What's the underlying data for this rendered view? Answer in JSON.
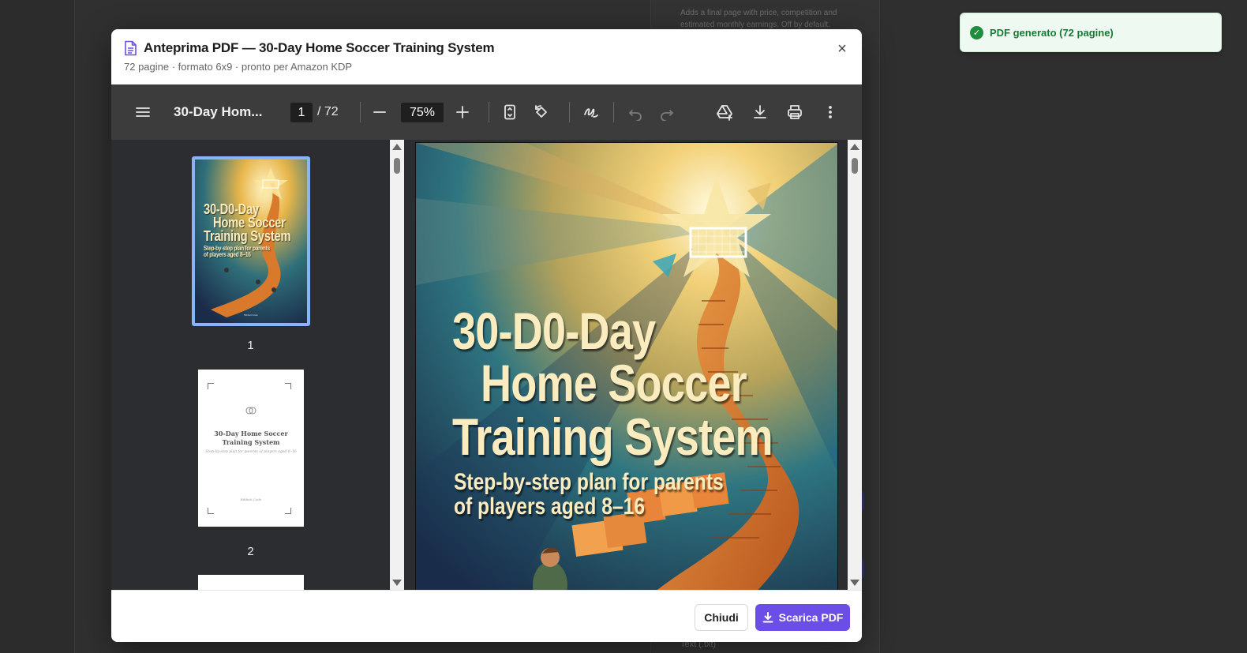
{
  "background": {
    "hint_text": "Adds a final page with price, competition and estimated monthly earnings. Off by default.",
    "footer_text": "Text (.txt)"
  },
  "toast": {
    "message": "PDF generato (72 pagine)",
    "icon": "check-circle-icon",
    "color": "#1e8e3e"
  },
  "modal": {
    "title": "Anteprima PDF — 30-Day Home Soccer Training System",
    "subtitle": "72 pagine · formato 6x9 · pronto per Amazon KDP",
    "close_symbol": "×"
  },
  "viewer": {
    "doc_name": "30-Day Hom...",
    "current_page": "1",
    "total_pages": "/ 72",
    "zoom": "75%",
    "toolbar_icons": [
      "menu-icon",
      "zoom-out-icon",
      "zoom-in-icon",
      "fit-page-icon",
      "rotate-icon",
      "annotate-icon",
      "undo-icon",
      "redo-icon",
      "save-to-drive-icon",
      "download-icon",
      "print-icon",
      "more-options-icon"
    ]
  },
  "thumbnails": [
    {
      "number": "1",
      "lines": [
        "30-D0-Day",
        "Home Soccer",
        "Training System"
      ],
      "sub": [
        "Step-by-step plan for parents",
        "of players aged 8–16"
      ]
    },
    {
      "number": "2",
      "title_lines": [
        "30-Day Home Soccer",
        "Training System"
      ],
      "sub": "Step-by-step plan for parents of players aged 8–16",
      "author": "Bibhuti Code"
    }
  ],
  "cover": {
    "title_line1": "30-D0-Day",
    "title_line2": "Home Soccer",
    "title_line3": "Training System",
    "subtitle_line1": "Step-by-step plan for parents",
    "subtitle_line2": "of players aged 8–16"
  },
  "footer": {
    "close_label": "Chiudi",
    "download_label": "Scarica PDF",
    "accent": "#6b4ee6"
  }
}
